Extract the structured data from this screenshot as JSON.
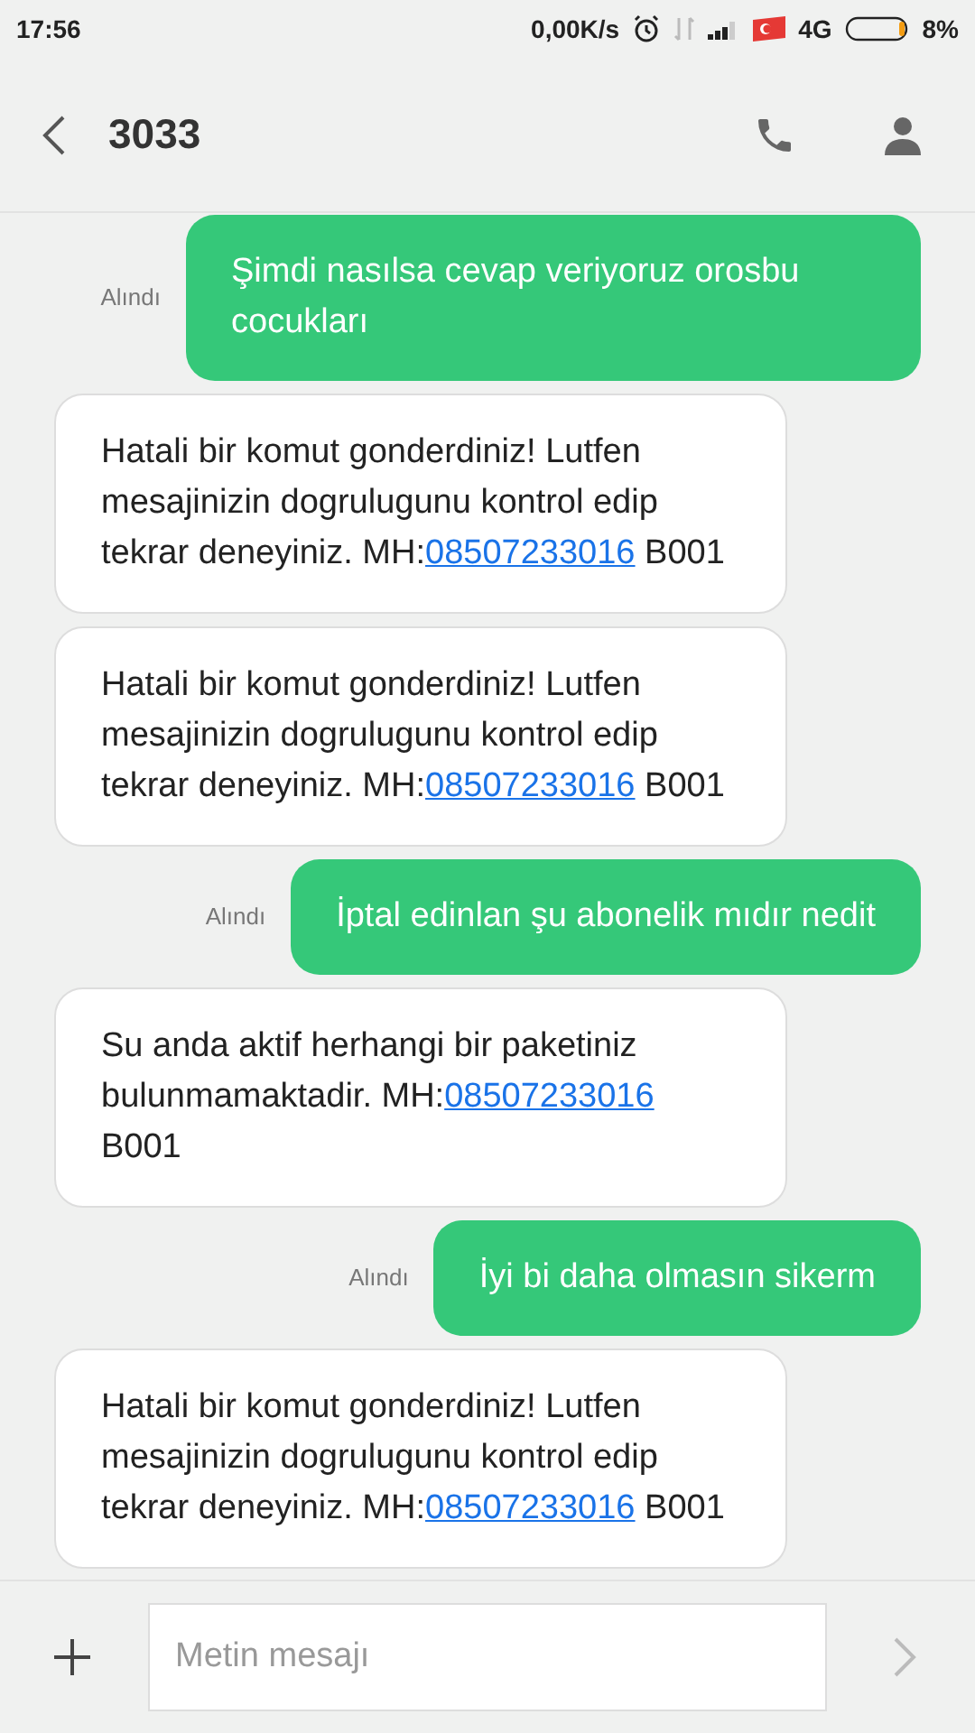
{
  "status_bar": {
    "time": "17:56",
    "speed": "0,00K/s",
    "network": "4G",
    "battery": "8%"
  },
  "header": {
    "title": "3033"
  },
  "messages": [
    {
      "kind": "sent",
      "status": "Alındı",
      "text": "Şimdi nasılsa cevap veriyoruz orosbu cocukları"
    },
    {
      "kind": "received",
      "text": "Hatali bir komut gonderdiniz! Lutfen mesajinizin dogrulugunu kontrol edip tekrar deneyiniz. MH:",
      "link": "08507233016",
      "after": " B001"
    },
    {
      "kind": "received",
      "text": "Hatali bir komut gonderdiniz! Lutfen mesajinizin dogrulugunu kontrol edip tekrar deneyiniz. MH:",
      "link": "08507233016",
      "after": " B001"
    },
    {
      "kind": "sent",
      "status": "Alındı",
      "text": "İptal edinlan şu abonelik mıdır nedit"
    },
    {
      "kind": "received",
      "text": "Su anda aktif herhangi bir paketiniz bulunmamaktadir. MH:",
      "link": "08507233016",
      "after": " B001"
    },
    {
      "kind": "sent",
      "status": "Alındı",
      "text": "İyi bi daha olmasın sikerm"
    },
    {
      "kind": "received",
      "text": "Hatali bir komut gonderdiniz! Lutfen mesajinizin dogrulugunu kontrol edip tekrar deneyiniz. MH:",
      "link": "08507233016",
      "after": " B001"
    }
  ],
  "composer": {
    "placeholder": "Metin mesajı"
  }
}
